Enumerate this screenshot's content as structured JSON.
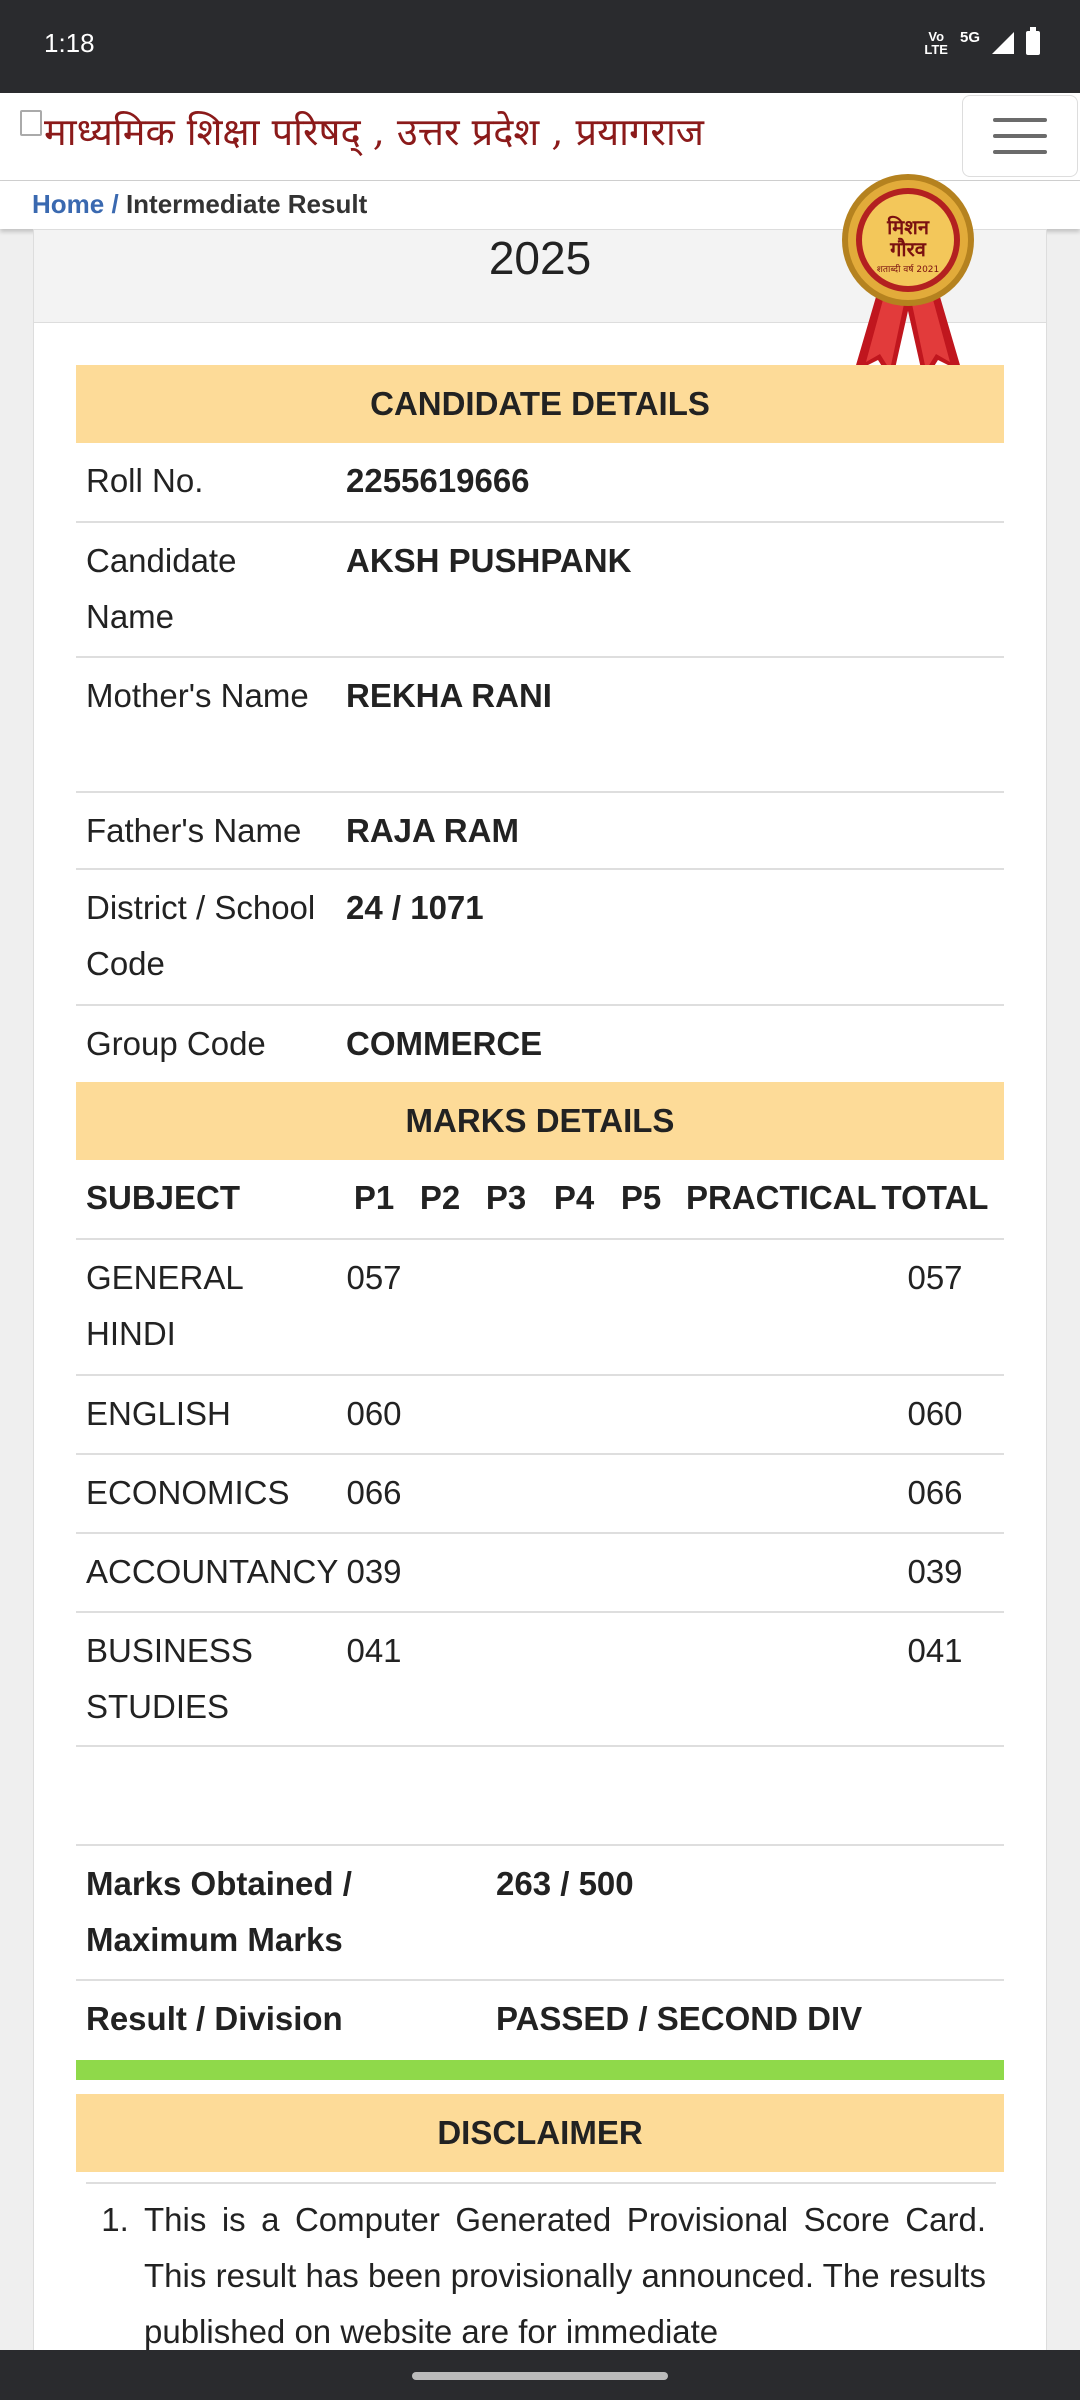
{
  "status_bar": {
    "time": "1:18",
    "network_top": "Vo",
    "network_mid": "LTE",
    "network_5g": "5G"
  },
  "header": {
    "logo_text": "माध्यमिक शिक्षा परिषद् , उत्तर प्रदेश , प्रयागराज"
  },
  "breadcrumb": {
    "home": "Home",
    "separator": "/",
    "current": "Intermediate Result"
  },
  "year": "2025",
  "badge": {
    "line1": "मिशन",
    "line2": "गौरव",
    "ribbon": "शताब्दी वर्ष 2021"
  },
  "candidate": {
    "title": "CANDIDATE DETAILS",
    "rows": [
      {
        "label": "Roll No.",
        "value": "2255619666"
      },
      {
        "label": "Candidate Name",
        "value": "AKSH PUSHPANK"
      },
      {
        "label": "Mother's Name",
        "value": "REKHA RANI"
      },
      {
        "label": "Father's Name",
        "value": "RAJA RAM"
      },
      {
        "label": "District / School Code",
        "value": "24 / 1071"
      },
      {
        "label": "Group Code",
        "value": "COMMERCE"
      }
    ]
  },
  "marks": {
    "title": "MARKS DETAILS",
    "headers": {
      "subject": "SUBJECT",
      "p1": "P1",
      "p2": "P2",
      "p3": "P3",
      "p4": "P4",
      "p5": "P5",
      "practical": "PRACTICAL",
      "total": "TOTAL"
    },
    "rows": [
      {
        "subject": "GENERAL HINDI",
        "p1": "057",
        "total": "057"
      },
      {
        "subject": "ENGLISH",
        "p1": "060",
        "total": "060"
      },
      {
        "subject": "ECONOMICS",
        "p1": "066",
        "total": "066"
      },
      {
        "subject": "ACCOUNTANCY",
        "p1": "039",
        "total": "039"
      },
      {
        "subject": "BUSINESS STUDIES",
        "p1": "041",
        "total": "041"
      }
    ]
  },
  "summary": {
    "marks_label": "Marks Obtained / Maximum Marks",
    "marks_value": "263 / 500",
    "result_label": "Result / Division",
    "result_value": "PASSED / SECOND DIV"
  },
  "disclaimer": {
    "title": "DISCLAIMER",
    "items": [
      {
        "num": "1.",
        "text": "This is a Computer Generated Provisional Score Card. This result has been provisionally announced. The results published on website are for immediate"
      }
    ]
  }
}
